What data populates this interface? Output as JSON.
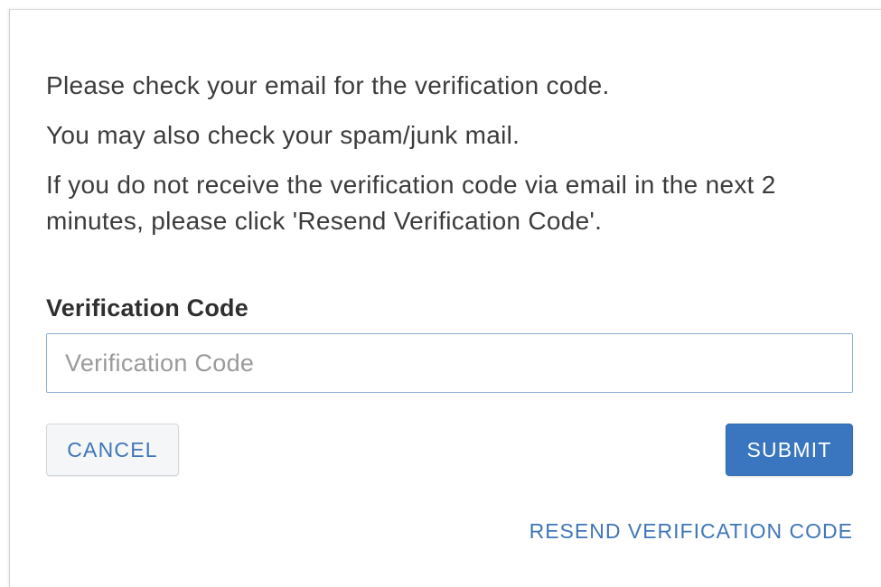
{
  "dialog": {
    "messages": [
      "Please check your email for the verification code.",
      "You may also check your spam/junk mail.",
      "If you do not receive the verification code via email in the next 2 minutes, please click 'Resend Verification Code'."
    ],
    "field_label": "Verification Code",
    "input": {
      "value": "",
      "placeholder": "Verification Code"
    },
    "cancel_label": "CANCEL",
    "submit_label": "SUBMIT",
    "resend_label": "RESEND VERIFICATION CODE"
  },
  "colors": {
    "accent": "#3a76bf",
    "link": "#3f76b8",
    "input_border": "#8aaed6"
  }
}
